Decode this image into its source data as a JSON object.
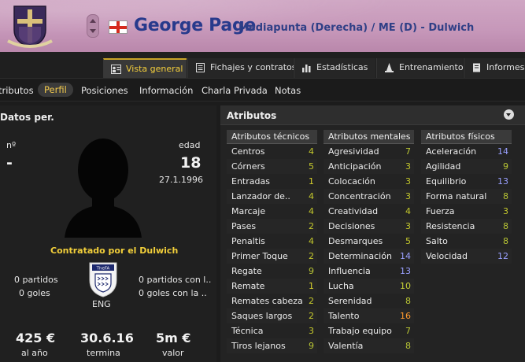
{
  "header": {
    "player_name": "George Page",
    "role": "Mediapunta (Derecha) / ME (D) - Dulwich",
    "nationality_flag": "England"
  },
  "tabs": [
    {
      "label": "Vista general",
      "icon": "overview-icon",
      "active": true
    },
    {
      "label": "Fichajes y contratos",
      "icon": "document-icon"
    },
    {
      "label": "Estadísticas",
      "icon": "bar-chart-icon"
    },
    {
      "label": "Entrenamiento",
      "icon": "training-cone-icon"
    },
    {
      "label": "Informes",
      "icon": "report-icon"
    }
  ],
  "subnav": [
    {
      "label": "tributos"
    },
    {
      "label": "Perfil",
      "active": true
    },
    {
      "label": "Posiciones"
    },
    {
      "label": "Información"
    },
    {
      "label": "Charla Privada"
    },
    {
      "label": "Notas"
    }
  ],
  "personal": {
    "title": "Datos per.",
    "number_label": "nº",
    "number_value": "-",
    "age_label": "edad",
    "age_value": "18",
    "dob": "27.1.1996",
    "contract": "Contratado por el Dulwich",
    "left_matches": "0 partidos",
    "left_goals": "0 goles",
    "right_matches": "0 partidos con l..",
    "right_goals": "0 goles con la ..",
    "nation_code": "ENG",
    "wage": "425 €",
    "wage_label": "al año",
    "expires": "30.6.16",
    "expires_label": "termina",
    "value": "5m €",
    "value_label": "valor"
  },
  "attributes": {
    "title": "Atributos",
    "technical": {
      "header": "Atributos técnicos",
      "rows": [
        {
          "name": "Centros",
          "value": "4"
        },
        {
          "name": "Córners",
          "value": "5"
        },
        {
          "name": "Entradas",
          "value": "1"
        },
        {
          "name": "Lanzador de..",
          "value": "4"
        },
        {
          "name": "Marcaje",
          "value": "4"
        },
        {
          "name": "Pases",
          "value": "2"
        },
        {
          "name": "Penaltis",
          "value": "4"
        },
        {
          "name": "Primer Toque",
          "value": "2"
        },
        {
          "name": "Regate",
          "value": "9"
        },
        {
          "name": "Remate",
          "value": "1"
        },
        {
          "name": "Remates cabeza",
          "value": "2"
        },
        {
          "name": "Saques largos",
          "value": "2"
        },
        {
          "name": "Técnica",
          "value": "3"
        },
        {
          "name": "Tiros lejanos",
          "value": "9"
        }
      ]
    },
    "mental": {
      "header": "Atributos mentales",
      "rows": [
        {
          "name": "Agresividad",
          "value": "7"
        },
        {
          "name": "Anticipación",
          "value": "3"
        },
        {
          "name": "Colocación",
          "value": "3"
        },
        {
          "name": "Concentración",
          "value": "3"
        },
        {
          "name": "Creatividad",
          "value": "4"
        },
        {
          "name": "Decisiones",
          "value": "3"
        },
        {
          "name": "Desmarques",
          "value": "5"
        },
        {
          "name": "Determinación",
          "value": "14"
        },
        {
          "name": "Influencia",
          "value": "13"
        },
        {
          "name": "Lucha",
          "value": "10"
        },
        {
          "name": "Serenidad",
          "value": "8"
        },
        {
          "name": "Talento",
          "value": "16"
        },
        {
          "name": "Trabajo equipo",
          "value": "7"
        },
        {
          "name": "Valentía",
          "value": "8"
        }
      ]
    },
    "physical": {
      "header": "Atributos físicos",
      "rows": [
        {
          "name": "Aceleración",
          "value": "14"
        },
        {
          "name": "Agilidad",
          "value": "9"
        },
        {
          "name": "Equilibrio",
          "value": "13"
        },
        {
          "name": "Forma natural",
          "value": "8"
        },
        {
          "name": "Fuerza",
          "value": "3"
        },
        {
          "name": "Resistencia",
          "value": "8"
        },
        {
          "name": "Salto",
          "value": "8"
        },
        {
          "name": "Velocidad",
          "value": "12"
        }
      ]
    }
  },
  "colors": {
    "header_bg": "#c697b9",
    "name_blue": "#283a8c",
    "accent_yellow": "#f2cf3a",
    "high_value_blue": "#9aa0ff",
    "top_value_orange": "#ff9a2e"
  }
}
